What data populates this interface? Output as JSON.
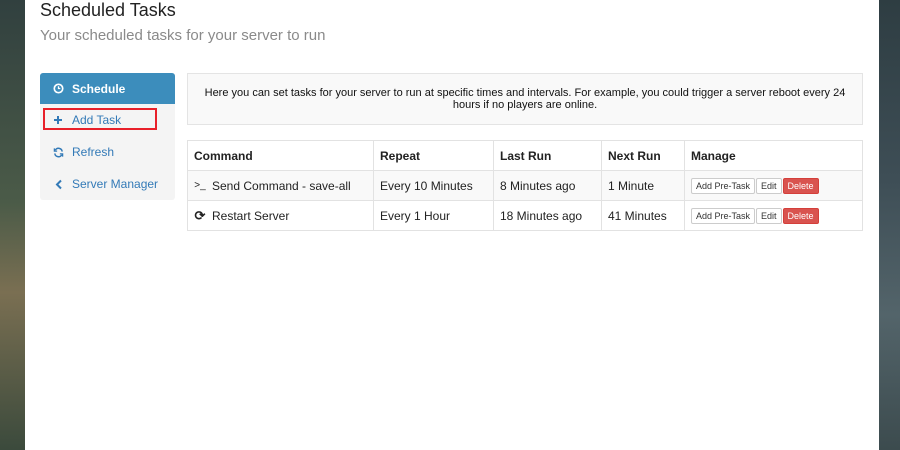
{
  "header": {
    "title": "Scheduled Tasks",
    "subtitle": "Your scheduled tasks for your server to run"
  },
  "sidebar": {
    "items": [
      {
        "label": "Schedule",
        "icon": "clock-icon",
        "active": true
      },
      {
        "label": "Add Task",
        "icon": "plus-icon",
        "highlighted": true
      },
      {
        "label": "Refresh",
        "icon": "refresh-icon"
      },
      {
        "label": "Server Manager",
        "icon": "chevron-left-icon"
      }
    ]
  },
  "info": {
    "text": "Here you can set tasks for your server to run at specific times and intervals. For example, you could trigger a server reboot every 24 hours if no players are online."
  },
  "table": {
    "columns": [
      "Command",
      "Repeat",
      "Last Run",
      "Next Run",
      "Manage"
    ],
    "rows": [
      {
        "icon": "terminal-icon",
        "icon_glyph": ">_",
        "command": "Send Command - save-all",
        "repeat": "Every 10 Minutes",
        "last_run": "8 Minutes ago",
        "next_run": "1 Minute"
      },
      {
        "icon": "refresh-icon",
        "icon_glyph": "⟳",
        "command": "Restart Server",
        "repeat": "Every 1 Hour",
        "last_run": "18 Minutes ago",
        "next_run": "41 Minutes"
      }
    ],
    "actions": {
      "pre_task": "Add Pre-Task",
      "edit": "Edit",
      "delete": "Delete"
    }
  },
  "colors": {
    "accent": "#3c8dbc",
    "link": "#337ab7",
    "danger": "#d9534f",
    "highlight_box": "#e8202a"
  }
}
